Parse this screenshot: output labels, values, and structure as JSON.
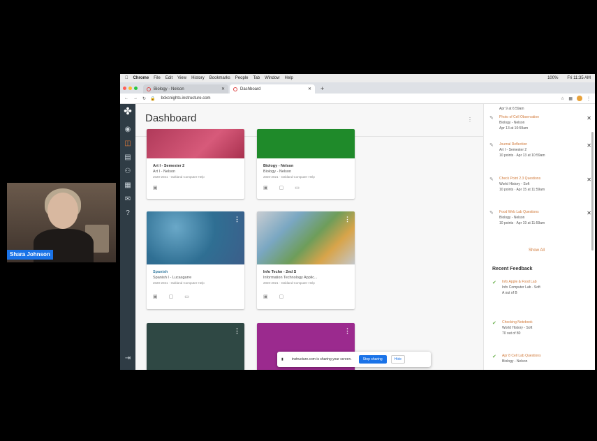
{
  "webcam": {
    "participant_name": "Shara Johnson"
  },
  "mac_menu": {
    "apple": "",
    "items": [
      "Chrome",
      "File",
      "Edit",
      "View",
      "History",
      "Bookmarks",
      "People",
      "Tab",
      "Window",
      "Help"
    ],
    "status": [
      "100%",
      "Fri 11:35 AM"
    ]
  },
  "browser": {
    "tabs": [
      {
        "label": "Biology - Nelson"
      },
      {
        "label": "Dashboard"
      }
    ],
    "new_tab": "+",
    "url": "bckcnights.instructure.com"
  },
  "rail": {
    "icons": [
      "logo-icon",
      "account-icon",
      "dashboard-icon",
      "courses-icon",
      "groups-icon",
      "calendar-icon",
      "inbox-icon",
      "help-icon",
      "collapse-icon"
    ]
  },
  "page": {
    "title": "Dashboard"
  },
  "cards": [
    {
      "title": "Art I - Semester 2",
      "subtitle": "Art I - Nelson",
      "meta": "2020-2021 · Oakland Computer Help",
      "color": "#c9415e"
    },
    {
      "title": "Biology - Nelson",
      "subtitle": "Biology - Nelson",
      "meta": "2020-2021 · Oakland Computer Help",
      "color": "#1f8a2a"
    },
    {
      "title": "Spanish",
      "subtitle": "Spanish I - Lucasgarre",
      "meta": "2020-2021 · Oakland Computer Help",
      "color": "#3b7fa3"
    },
    {
      "title": "Info Techn - 2nd S",
      "subtitle": "Information Technology Applic...",
      "meta": "2020-2021 · Oakland Computer Help",
      "color": "#5b8fa8"
    },
    {
      "title": "",
      "subtitle": "",
      "meta": "",
      "color": "#2f4844"
    },
    {
      "title": "",
      "subtitle": "",
      "meta": "",
      "color": "#9b2a8e"
    }
  ],
  "todo": [
    {
      "link": "Apr 9 at 6:59am",
      "line2": "",
      "line3": ""
    },
    {
      "link": "Photo of Cell Observation",
      "line2": "Biology - Nelson",
      "line3": "Apr 13 at 10:59am"
    },
    {
      "link": "Journal Reflection",
      "line2": "Art I - Semester 2",
      "line3": "10 points · Apr 13 at 10:59am"
    },
    {
      "link": "Check Point 2.3 Questions",
      "line2": "World History - Soft",
      "line3": "10 points · Apr 15 at 11:59am"
    },
    {
      "link": "Food Web Lab Questions",
      "line2": "Biology - Nelson",
      "line3": "10 points · Apr 19 at 11:59am"
    }
  ],
  "show_all": "Show All",
  "feedback_heading": "Recent Feedback",
  "feedback": [
    {
      "link": "Info Apple & Food Lab",
      "line2": "Info Computer Lab · Soft",
      "line3": "A out of B"
    },
    {
      "link": "Checking Notebook",
      "line2": "World History - Soft",
      "line3": "70 out of 80"
    },
    {
      "link": "Apr 8 Cell Lab Questions",
      "line2": "Biology - Nelson",
      "line3": ""
    }
  ],
  "share_banner": {
    "message": "instructure.com is sharing your screen.",
    "stop_label": "Stop sharing",
    "hide_label": "Hide"
  },
  "colors": {
    "rail": "#2f3c45",
    "link": "#d17a3a",
    "accent": "#1a73e8"
  }
}
